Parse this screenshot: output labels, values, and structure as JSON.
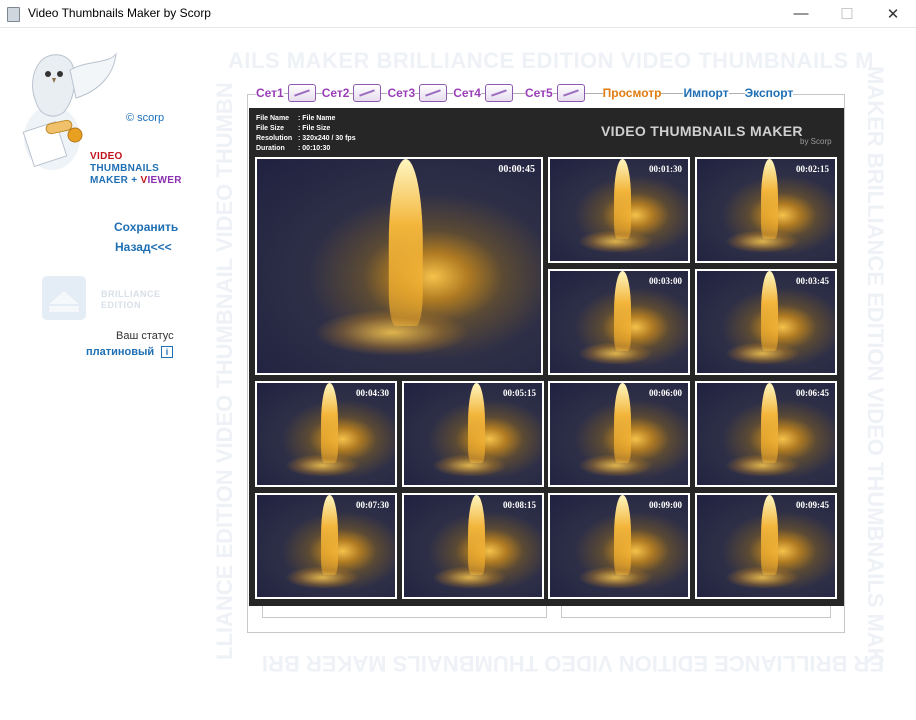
{
  "window": {
    "title": "Video Thumbnails Maker by Scorp",
    "minimize": "—",
    "maximize": "☐",
    "close": "✕"
  },
  "watermark": {
    "top": "AILS MAKER BRILLIANCE EDITION VIDEO THUMBNAILS M",
    "right": "MAKER BRILLIANCE EDITION VIDEO THUMBNAILS MAK",
    "bottom": "ER BRILLIANCE EDITION VIDEO THUMBNAILS MAKER BRI",
    "left": "LLIANCE EDITION VIDEO THUMBNAIL VIDEO THUMBN"
  },
  "sidebar": {
    "copyright": "© scorp",
    "logo": {
      "line1_a": "V",
      "line1_b": "IDEO",
      "line2": "THUMBNAILS",
      "line3_a": "MAKER + ",
      "line3_b": "V",
      "line3_c": "IEWER"
    },
    "save": "Сохранить",
    "back": "Назад<<<",
    "brilliance_1": "BRILLIANCE",
    "brilliance_2": "EDITION",
    "status_label": "Ваш статус",
    "status_value": "платиновый",
    "info_icon": "i"
  },
  "tabs": [
    {
      "label": "Сет1"
    },
    {
      "label": "Сет2"
    },
    {
      "label": "Сет3"
    },
    {
      "label": "Сет4"
    },
    {
      "label": "Сет5"
    }
  ],
  "tab_actions": {
    "preview": "Просмотр",
    "import": "Импорт",
    "export": "Экспорт"
  },
  "preview": {
    "info": [
      {
        "key": "File Name",
        "value": "File Name"
      },
      {
        "key": "File Size",
        "value": "File Size"
      },
      {
        "key": "Resolution",
        "value": "320x240 / 30 fps"
      },
      {
        "key": "Duration",
        "value": "00:10:30"
      }
    ],
    "brand": "VIDEO THUMBNAILS MAKER",
    "brand_sub": "by Scorp",
    "thumbnails": [
      "00:00:45",
      "00:01:30",
      "00:02:15",
      "00:03:00",
      "00:03:45",
      "00:04:30",
      "00:05:15",
      "00:06:00",
      "00:06:45",
      "00:07:30",
      "00:08:15",
      "00:09:00",
      "00:09:45"
    ]
  },
  "colors": {
    "accent_blue": "#1f6fb4",
    "set_purple": "#9a3fb8",
    "preview_orange": "#e07c10",
    "logo_red": "#c0141c",
    "logo_purple": "#8a2fb0",
    "preview_bg": "#262626"
  }
}
